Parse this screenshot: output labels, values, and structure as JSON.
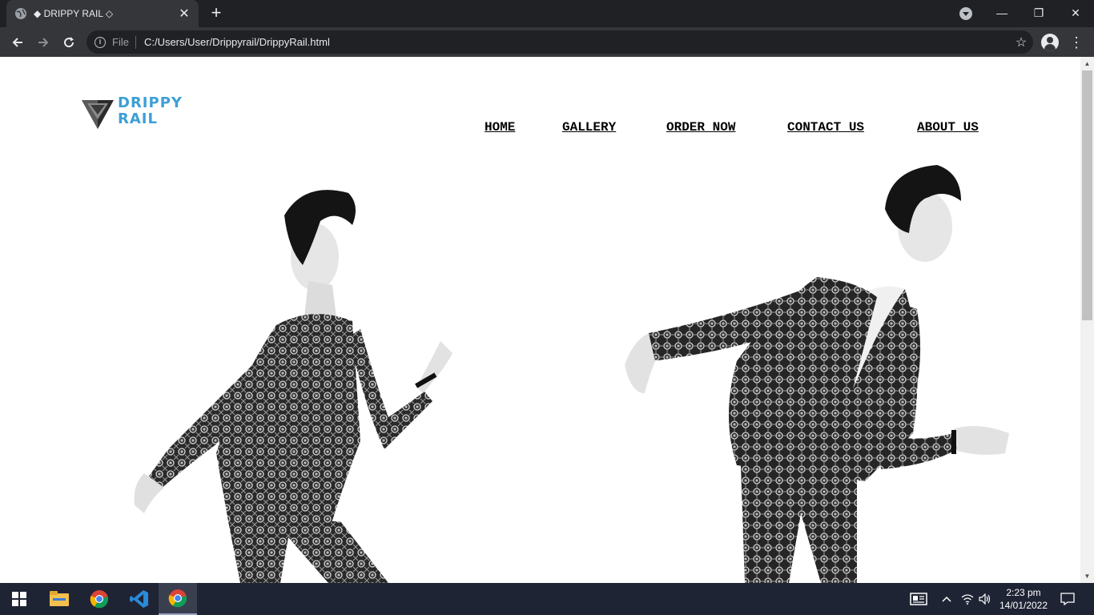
{
  "browser": {
    "tab_title": "◆ DRIPPY RAIL ◇",
    "tab_close": "✕",
    "new_tab": "+",
    "address": {
      "scheme_label": "File",
      "url": "C:/Users/User/Drippyrail/DrippyRail.html"
    },
    "window_controls": {
      "minimize": "—",
      "restore": "❐",
      "close": "✕"
    }
  },
  "site": {
    "logo": {
      "line1": "DRIPPY",
      "line2": "RAIL"
    },
    "nav": [
      {
        "label": "HOME"
      },
      {
        "label": "GALLERY"
      },
      {
        "label": "ORDER NOW"
      },
      {
        "label": "CONTACT US"
      },
      {
        "label": "ABOUT US"
      }
    ]
  },
  "taskbar": {
    "clock": {
      "time": "2:23 pm",
      "date": "14/01/2022"
    }
  },
  "colors": {
    "browser_dark": "#202124",
    "browser_toolbar": "#35363a",
    "logo_blue": "#3d9fd6",
    "taskbar": "#1f2435"
  },
  "icons": {
    "tab_favicon": "globe-icon",
    "back": "back-arrow-icon",
    "forward": "forward-arrow-icon",
    "reload": "reload-icon",
    "bookmark": "star-icon",
    "menu": "kebab-menu-icon"
  }
}
